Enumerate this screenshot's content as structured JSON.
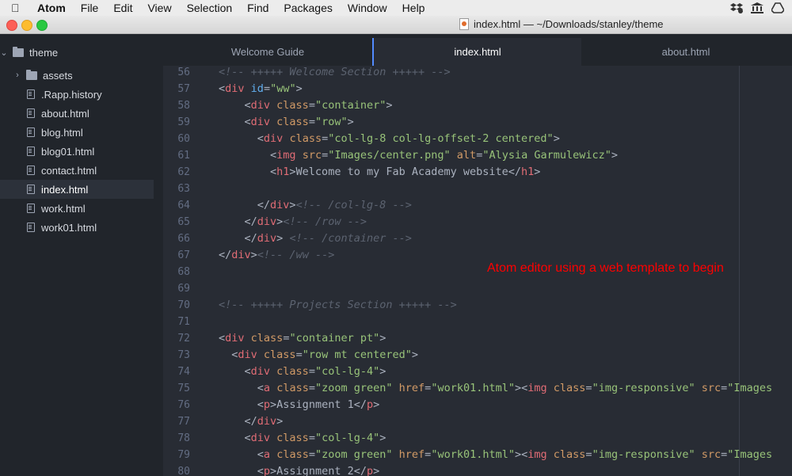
{
  "menubar": {
    "app": "Atom",
    "items": [
      "File",
      "Edit",
      "View",
      "Selection",
      "Find",
      "Packages",
      "Window",
      "Help"
    ]
  },
  "window": {
    "title": "index.html — ~/Downloads/stanley/theme"
  },
  "sidebar": {
    "root": "theme",
    "folder": "assets",
    "files": [
      ".Rapp.history",
      "about.html",
      "blog.html",
      "blog01.html",
      "contact.html",
      "index.html",
      "work.html",
      "work01.html"
    ],
    "selected": "index.html"
  },
  "tabs": [
    "Welcome Guide",
    "index.html",
    "about.html"
  ],
  "active_tab": "index.html",
  "annotation": "Atom editor using a web template to begin",
  "code_lines": [
    {
      "n": "56",
      "text": "<!-- +++++ Welcome Section +++++ -->"
    },
    {
      "n": "57",
      "text": "<div id=\"ww\">"
    },
    {
      "n": "58",
      "text": "    <div class=\"container\">"
    },
    {
      "n": "59",
      "text": "    <div class=\"row\">"
    },
    {
      "n": "60",
      "text": "      <div class=\"col-lg-8 col-lg-offset-2 centered\">"
    },
    {
      "n": "61",
      "text": "        <img src=\"Images/center.png\" alt=\"Alysia Garmulewicz\">"
    },
    {
      "n": "62",
      "text": "        <h1>Welcome to my Fab Academy website</h1>"
    },
    {
      "n": "63",
      "text": ""
    },
    {
      "n": "64",
      "text": "      </div><!-- /col-lg-8 -->"
    },
    {
      "n": "65",
      "text": "    </div><!-- /row -->"
    },
    {
      "n": "66",
      "text": "    </div> <!-- /container -->"
    },
    {
      "n": "67",
      "text": "</div><!-- /ww -->"
    },
    {
      "n": "68",
      "text": ""
    },
    {
      "n": "69",
      "text": ""
    },
    {
      "n": "70",
      "text": "<!-- +++++ Projects Section +++++ -->"
    },
    {
      "n": "71",
      "text": ""
    },
    {
      "n": "72",
      "text": "<div class=\"container pt\">"
    },
    {
      "n": "73",
      "text": "  <div class=\"row mt centered\">"
    },
    {
      "n": "74",
      "text": "    <div class=\"col-lg-4\">"
    },
    {
      "n": "75",
      "text": "      <a class=\"zoom green\" href=\"work01.html\"><img class=\"img-responsive\" src=\"Images"
    },
    {
      "n": "76",
      "text": "      <p>Assignment 1</p>"
    },
    {
      "n": "77",
      "text": "    </div>"
    },
    {
      "n": "78",
      "text": "    <div class=\"col-lg-4\">"
    },
    {
      "n": "79",
      "text": "      <a class=\"zoom green\" href=\"work01.html\"><img class=\"img-responsive\" src=\"Images"
    },
    {
      "n": "80",
      "text": "      <p>Assignment 2</p>"
    }
  ],
  "colors": {
    "editor_bg": "#282c34",
    "sidebar_bg": "#21252b",
    "tag": "#e06c75",
    "attribute": "#d19a66",
    "string": "#98c379",
    "comment": "#5c6370",
    "id_attr": "#61afef",
    "annotation": "#ff0000"
  }
}
